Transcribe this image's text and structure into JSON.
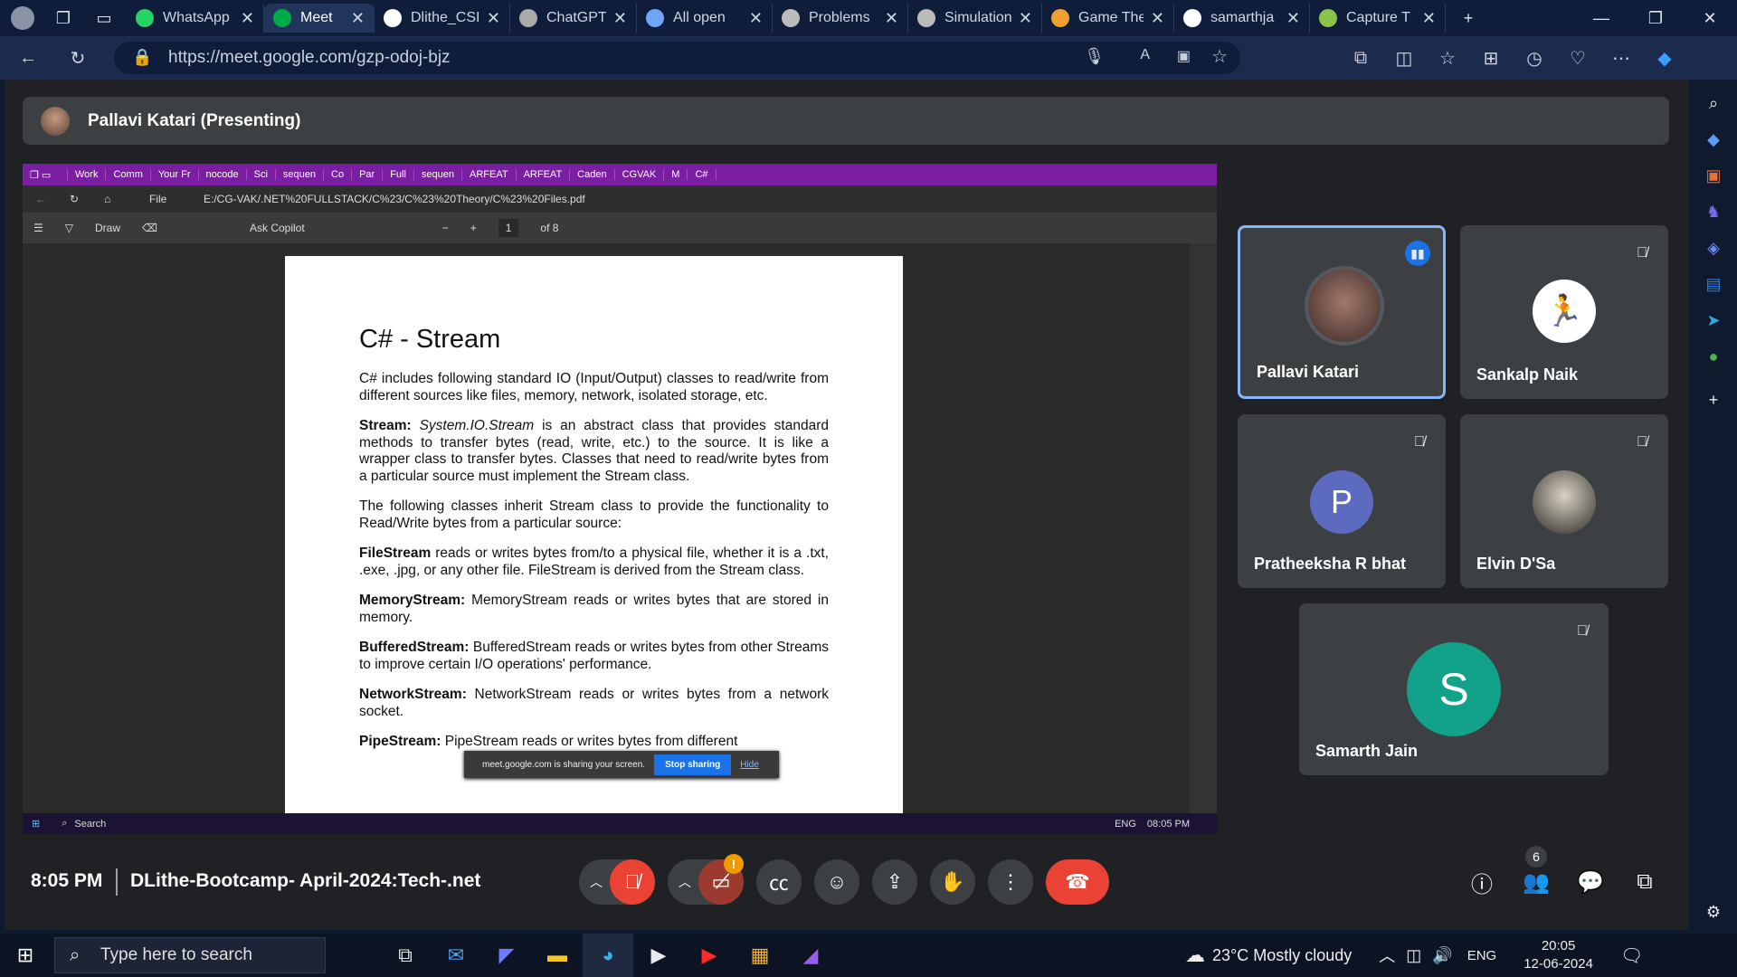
{
  "browser": {
    "tabs": [
      {
        "label": "WhatsApp",
        "icon": "whatsapp-icon",
        "color": "#25d366"
      },
      {
        "label": "Meet",
        "icon": "meet-icon",
        "color": "#00ac47",
        "active": true
      },
      {
        "label": "Dlithe_CSI",
        "icon": "github-icon",
        "color": "#ffffff"
      },
      {
        "label": "ChatGPT",
        "icon": "chatgpt-icon",
        "color": "#aaaaaa"
      },
      {
        "label": "All open",
        "icon": "link-icon",
        "color": "#6ea8fe"
      },
      {
        "label": "Problems",
        "icon": "problems-icon",
        "color": "#bbbbbb"
      },
      {
        "label": "Simulation",
        "icon": "simulation-icon",
        "color": "#bbbbbb"
      },
      {
        "label": "Game The",
        "icon": "game-icon",
        "color": "#f0a030"
      },
      {
        "label": "samarthja",
        "icon": "github-icon",
        "color": "#ffffff"
      },
      {
        "label": "Capture T",
        "icon": "capture-icon",
        "color": "#8bc34a"
      }
    ],
    "url": "https://meet.google.com/gzp-odoj-bjz"
  },
  "meet": {
    "presenter_banner": "Pallavi Katari (Presenting)",
    "time": "8:05 PM",
    "meeting_name": "DLithe-Bootcamp- April-2024:Tech-.net",
    "participant_count": "6",
    "participants": [
      {
        "name": "Pallavi Katari",
        "speaking": true,
        "avatar_type": "photo",
        "color": "#8ab4f8"
      },
      {
        "name": "Sankalp Naik",
        "muted": true,
        "avatar_type": "photo"
      },
      {
        "name": "Pratheeksha R bhat",
        "muted": true,
        "initial": "P",
        "color": "#5c6bc0"
      },
      {
        "name": "Elvin D'Sa",
        "muted": true,
        "avatar_type": "photo"
      },
      {
        "name": "Samarth Jain",
        "muted": true,
        "initial": "S",
        "color": "#12a28a"
      }
    ]
  },
  "shared_screen": {
    "tabs": [
      "Work",
      "Comm",
      "Your Fr",
      "nocode",
      "Sci",
      "sequen",
      "Co",
      "Par",
      "Full",
      "sequen",
      "ARFEAT",
      "ARFEAT",
      "Caden",
      "CGVAK",
      "M",
      "C#"
    ],
    "file_label": "File",
    "path": "E:/CG-VAK/.NET%20FULLSTACK/C%23/C%23%20Theory/C%23%20Files.pdf",
    "toolbar": {
      "draw": "Draw",
      "copilot": "Ask Copilot",
      "page": "1",
      "of": "of 8"
    },
    "pdf": {
      "title": "C# - Stream",
      "paragraphs": [
        {
          "lead": "",
          "text": "C# includes following standard IO (Input/Output) classes to read/write from different sources like files, memory, network, isolated storage, etc."
        },
        {
          "lead": "Stream:",
          "italic": "System.IO.Stream",
          "text": " is an abstract class that provides standard methods to transfer bytes (read, write, etc.) to the source. It is like a wrapper class to transfer bytes. Classes that need to read/write bytes from a particular source must implement the Stream class."
        },
        {
          "lead": "",
          "text": "The following classes inherit Stream class to provide the functionality to Read/Write bytes from a particular source:"
        },
        {
          "lead": "FileStream",
          "text": " reads or writes bytes from/to a physical file, whether it is a .txt, .exe, .jpg, or any other file. FileStream is derived from the Stream class."
        },
        {
          "lead": "MemoryStream:",
          "text": " MemoryStream reads or writes bytes that are stored in memory."
        },
        {
          "lead": "BufferedStream:",
          "text": " BufferedStream reads or writes bytes from other Streams to improve certain I/O operations' performance."
        },
        {
          "lead": "NetworkStream:",
          "text": " NetworkStream reads or writes bytes from a network socket."
        },
        {
          "lead": "PipeStream:",
          "text": " PipeStream reads or writes bytes from different"
        }
      ]
    },
    "share_banner": {
      "text": "meet.google.com is sharing your screen.",
      "stop": "Stop sharing",
      "hide": "Hide"
    },
    "taskbar": {
      "search": "Search",
      "lang": "ENG",
      "time": "08:05 PM"
    }
  },
  "taskbar": {
    "search_placeholder": "Type here to search",
    "weather": "23°C  Mostly cloudy",
    "lang": "ENG",
    "time": "20:05",
    "date": "12-06-2024"
  },
  "colors": {
    "meet_bg": "#202124",
    "tile_bg": "#3c4043",
    "end_call": "#ea4335",
    "shared_tabbar": "#7b1fa2",
    "speaking_border": "#8ab4f8"
  }
}
